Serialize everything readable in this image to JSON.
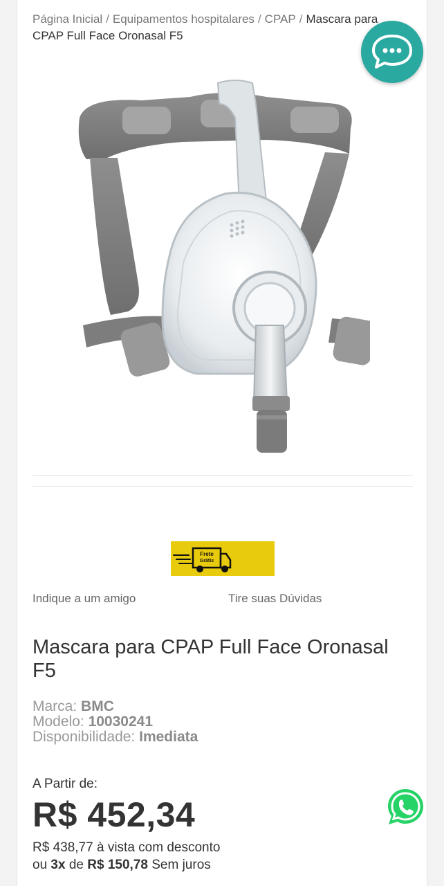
{
  "breadcrumb": {
    "items": [
      "Página Inicial",
      "Equipamentos hospitalares",
      "CPAP"
    ],
    "current": "Mascara para CPAP Full Face Oronasal F5"
  },
  "badge": {
    "line1": "Frete",
    "line2": "Grátis"
  },
  "links": {
    "refer_friend": "Indique a um amigo",
    "questions": "Tire suas Dúvidas"
  },
  "product": {
    "title": "Mascara para CPAP Full Face Oronasal F5",
    "brand_label": "Marca:",
    "brand": "BMC",
    "model_label": "Modelo:",
    "model": "10030241",
    "availability_label": "Disponibilidade:",
    "availability": "Imediata"
  },
  "pricing": {
    "from_label": "A Partir de:",
    "price": "R$ 452,34",
    "cash_price": "R$ 438,77",
    "cash_text": "à vista com desconto",
    "inst_prefix": "ou",
    "inst_count": "3x",
    "inst_de": "de",
    "inst_value": "R$ 150,78",
    "inst_suffix": "Sem juros"
  },
  "colors": {
    "chat_accent": "#2aa9a0",
    "whatsapp": "#25d366",
    "badge": "#e8cb0c"
  },
  "icons": {
    "chat": "chat-bubble-icon",
    "whatsapp": "whatsapp-icon",
    "truck": "delivery-truck-icon"
  }
}
